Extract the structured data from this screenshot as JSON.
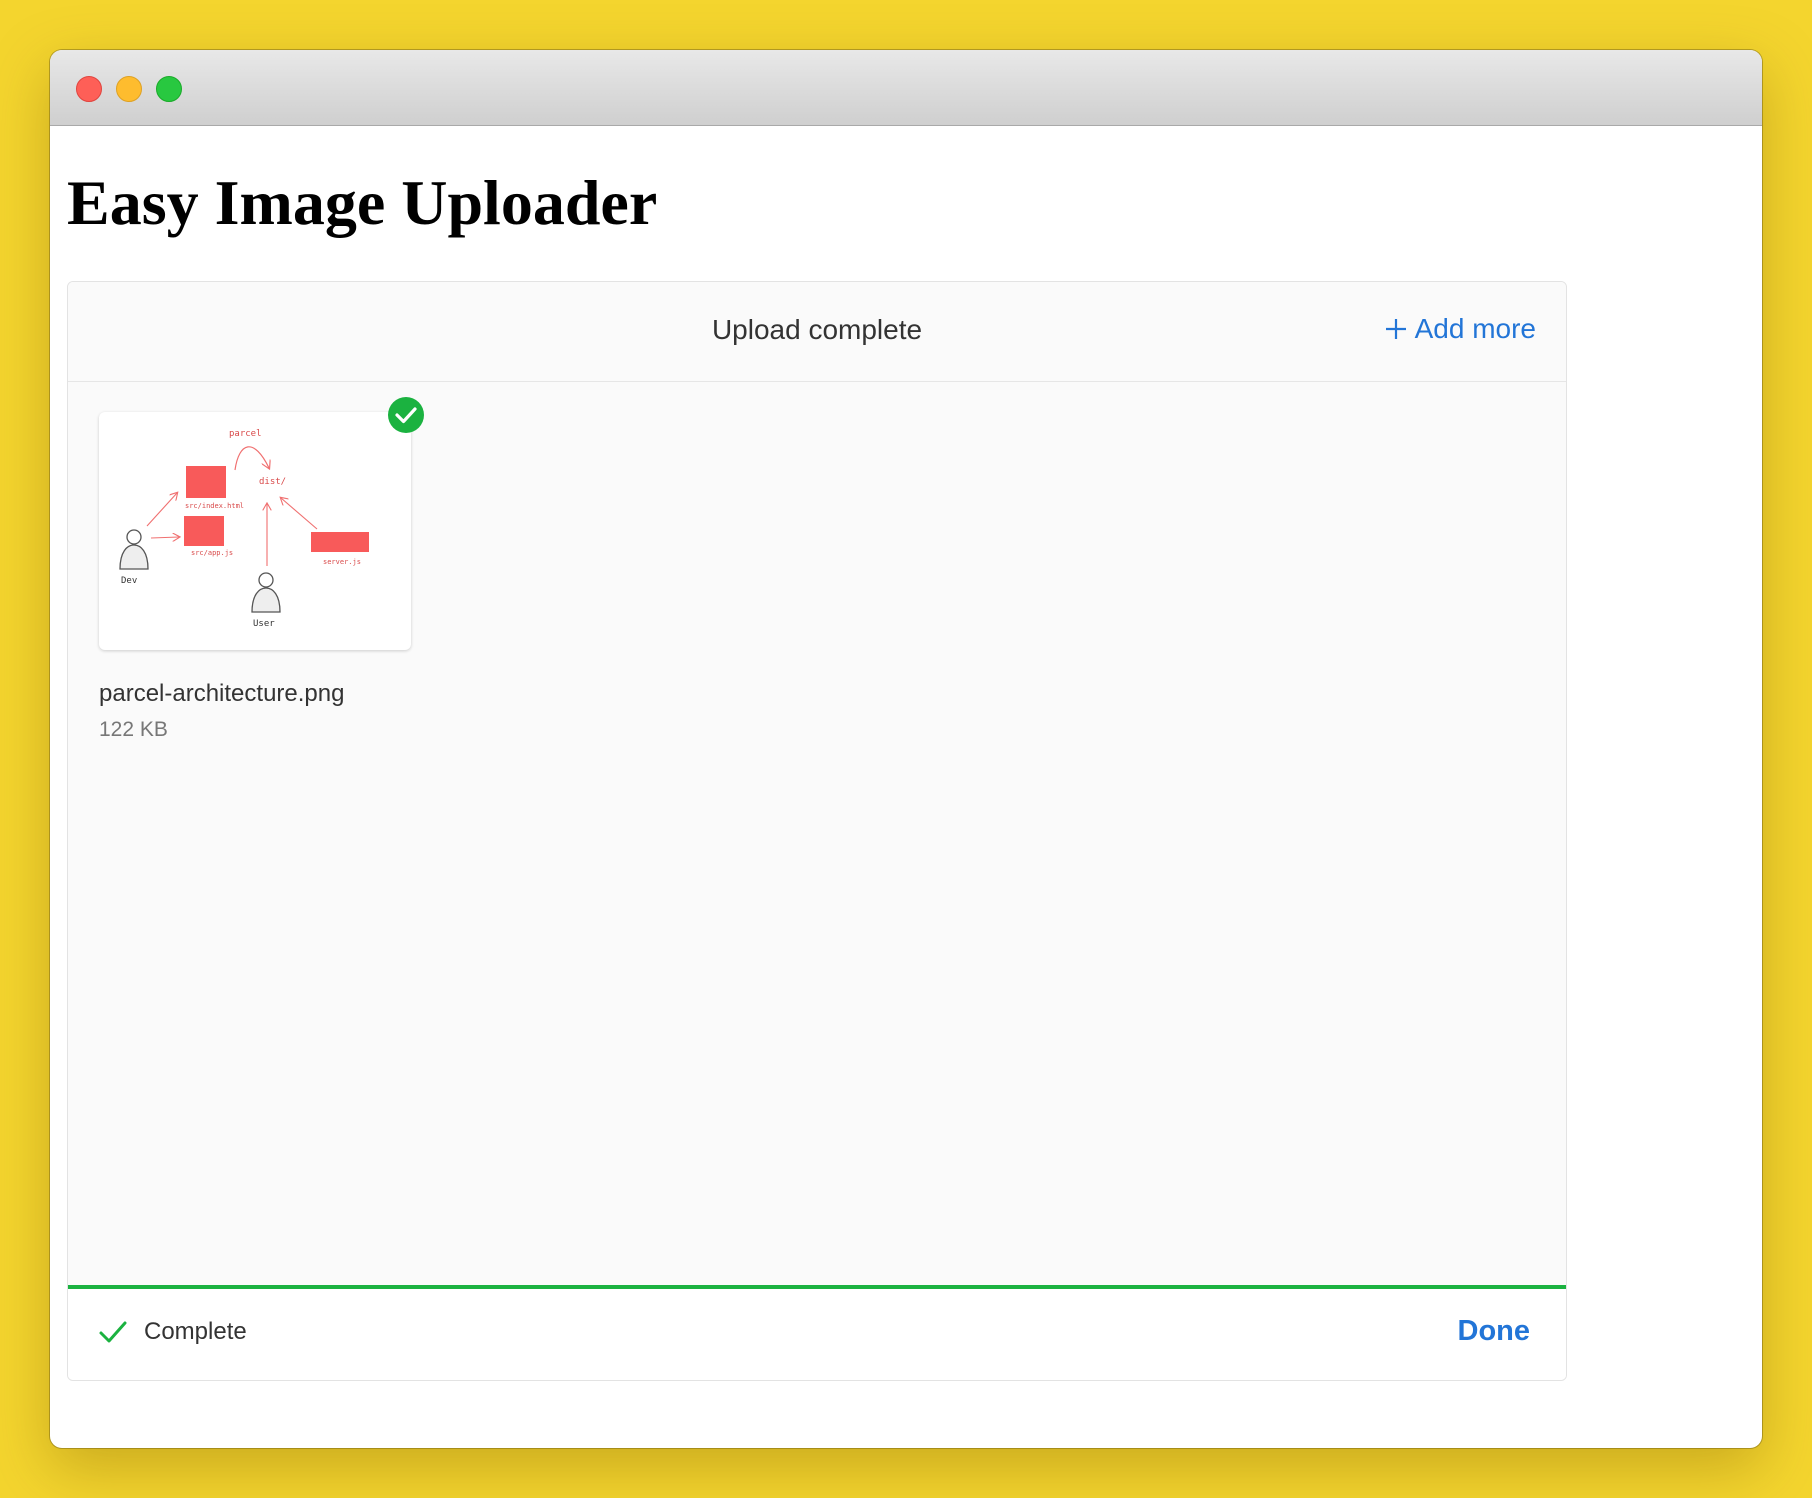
{
  "window": {
    "controls": [
      "close",
      "minimize",
      "maximize"
    ]
  },
  "page": {
    "title": "Easy Image Uploader"
  },
  "dashboard": {
    "header": {
      "title": "Upload complete",
      "add_more_icon": "plus-icon",
      "add_more_label": "Add more"
    },
    "files": [
      {
        "name": "parcel-architecture.png",
        "size": "122 KB",
        "status_icon": "check-circle-icon",
        "thumbnail_labels": {
          "parcel": "parcel",
          "dist": "dist/",
          "index": "src/index.html",
          "app": "src/app.js",
          "server": "server.js",
          "dev": "Dev",
          "user": "User"
        }
      }
    ],
    "progress": 1.0,
    "footer": {
      "status_icon": "check-icon",
      "status_text": "Complete",
      "done_label": "Done"
    }
  },
  "colors": {
    "background": "#f4d52e",
    "accent": "#2275d7",
    "success": "#1bb240",
    "thumbnail_red": "#f85a5a"
  }
}
